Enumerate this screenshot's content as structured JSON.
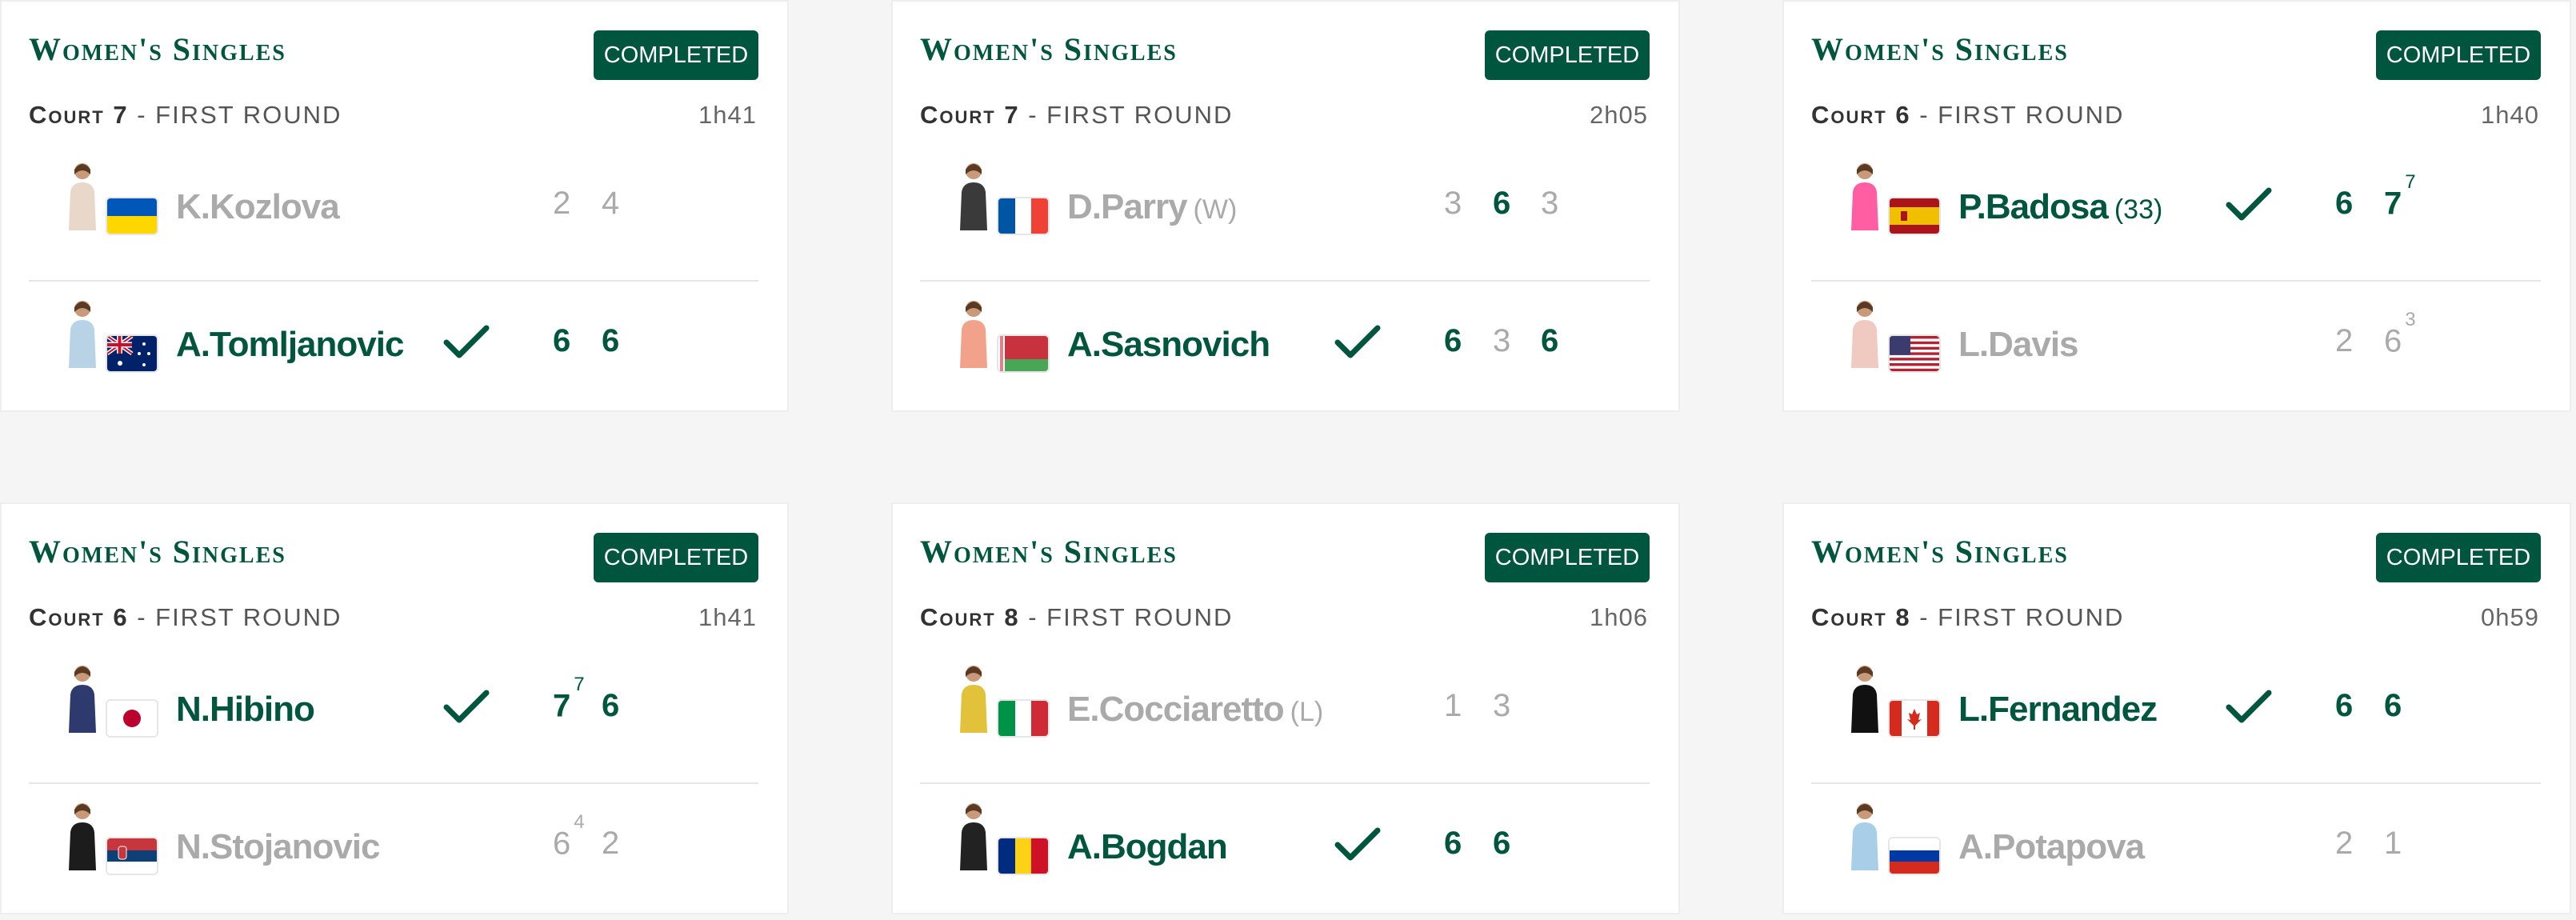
{
  "matches": [
    {
      "event": "Women's Singles",
      "status": "COMPLETED",
      "court": "Court 7",
      "round": " - FIRST ROUND",
      "duration": "1h41",
      "players": [
        {
          "name": "K.Kozlova",
          "seed": "",
          "winner": false,
          "flag": "ukraine",
          "scores": [
            {
              "v": "2",
              "tb": ""
            },
            {
              "v": "4",
              "tb": ""
            }
          ],
          "set_wins": [
            false,
            false
          ]
        },
        {
          "name": "A.Tomljanovic",
          "seed": "",
          "winner": true,
          "flag": "australia",
          "scores": [
            {
              "v": "6",
              "tb": ""
            },
            {
              "v": "6",
              "tb": ""
            }
          ],
          "set_wins": [
            true,
            true
          ]
        }
      ]
    },
    {
      "event": "Women's Singles",
      "status": "COMPLETED",
      "court": "Court 7",
      "round": " - FIRST ROUND",
      "duration": "2h05",
      "players": [
        {
          "name": "D.Parry",
          "seed": "(W)",
          "winner": false,
          "flag": "france",
          "scores": [
            {
              "v": "3",
              "tb": ""
            },
            {
              "v": "6",
              "tb": ""
            },
            {
              "v": "3",
              "tb": ""
            }
          ],
          "set_wins": [
            false,
            true,
            false
          ]
        },
        {
          "name": "A.Sasnovich",
          "seed": "",
          "winner": true,
          "flag": "belarus",
          "scores": [
            {
              "v": "6",
              "tb": ""
            },
            {
              "v": "3",
              "tb": ""
            },
            {
              "v": "6",
              "tb": ""
            }
          ],
          "set_wins": [
            true,
            false,
            true
          ]
        }
      ]
    },
    {
      "event": "Women's Singles",
      "status": "COMPLETED",
      "court": "Court 6",
      "round": " - FIRST ROUND",
      "duration": "1h40",
      "players": [
        {
          "name": "P.Badosa",
          "seed": "(33)",
          "winner": true,
          "flag": "spain",
          "scores": [
            {
              "v": "6",
              "tb": ""
            },
            {
              "v": "7",
              "tb": "7"
            }
          ],
          "set_wins": [
            true,
            true
          ]
        },
        {
          "name": "L.Davis",
          "seed": "",
          "winner": false,
          "flag": "usa",
          "scores": [
            {
              "v": "2",
              "tb": ""
            },
            {
              "v": "6",
              "tb": "3"
            }
          ],
          "set_wins": [
            false,
            false
          ]
        }
      ]
    },
    {
      "event": "Women's Singles",
      "status": "COMPLETED",
      "court": "Court 6",
      "round": " - FIRST ROUND",
      "duration": "1h41",
      "players": [
        {
          "name": "N.Hibino",
          "seed": "",
          "winner": true,
          "flag": "japan",
          "scores": [
            {
              "v": "7",
              "tb": "7"
            },
            {
              "v": "6",
              "tb": ""
            }
          ],
          "set_wins": [
            true,
            true
          ]
        },
        {
          "name": "N.Stojanovic",
          "seed": "",
          "winner": false,
          "flag": "serbia",
          "scores": [
            {
              "v": "6",
              "tb": "4"
            },
            {
              "v": "2",
              "tb": ""
            }
          ],
          "set_wins": [
            false,
            false
          ]
        }
      ]
    },
    {
      "event": "Women's Singles",
      "status": "COMPLETED",
      "court": "Court 8",
      "round": " - FIRST ROUND",
      "duration": "1h06",
      "players": [
        {
          "name": "E.Cocciaretto",
          "seed": "(L)",
          "winner": false,
          "flag": "italy",
          "scores": [
            {
              "v": "1",
              "tb": ""
            },
            {
              "v": "3",
              "tb": ""
            }
          ],
          "set_wins": [
            false,
            false
          ]
        },
        {
          "name": "A.Bogdan",
          "seed": "",
          "winner": true,
          "flag": "romania",
          "scores": [
            {
              "v": "6",
              "tb": ""
            },
            {
              "v": "6",
              "tb": ""
            }
          ],
          "set_wins": [
            true,
            true
          ]
        }
      ]
    },
    {
      "event": "Women's Singles",
      "status": "COMPLETED",
      "court": "Court 8",
      "round": " - FIRST ROUND",
      "duration": "0h59",
      "players": [
        {
          "name": "L.Fernandez",
          "seed": "",
          "winner": true,
          "flag": "canada",
          "scores": [
            {
              "v": "6",
              "tb": ""
            },
            {
              "v": "6",
              "tb": ""
            }
          ],
          "set_wins": [
            true,
            true
          ]
        },
        {
          "name": "A.Potapova",
          "seed": "",
          "winner": false,
          "flag": "russia",
          "scores": [
            {
              "v": "2",
              "tb": ""
            },
            {
              "v": "1",
              "tb": ""
            }
          ],
          "set_wins": [
            false,
            false
          ]
        }
      ]
    }
  ],
  "colors": {
    "accent": "#00553e",
    "loser_text": "#aaaaaa",
    "badge_text": "#ffffff"
  }
}
